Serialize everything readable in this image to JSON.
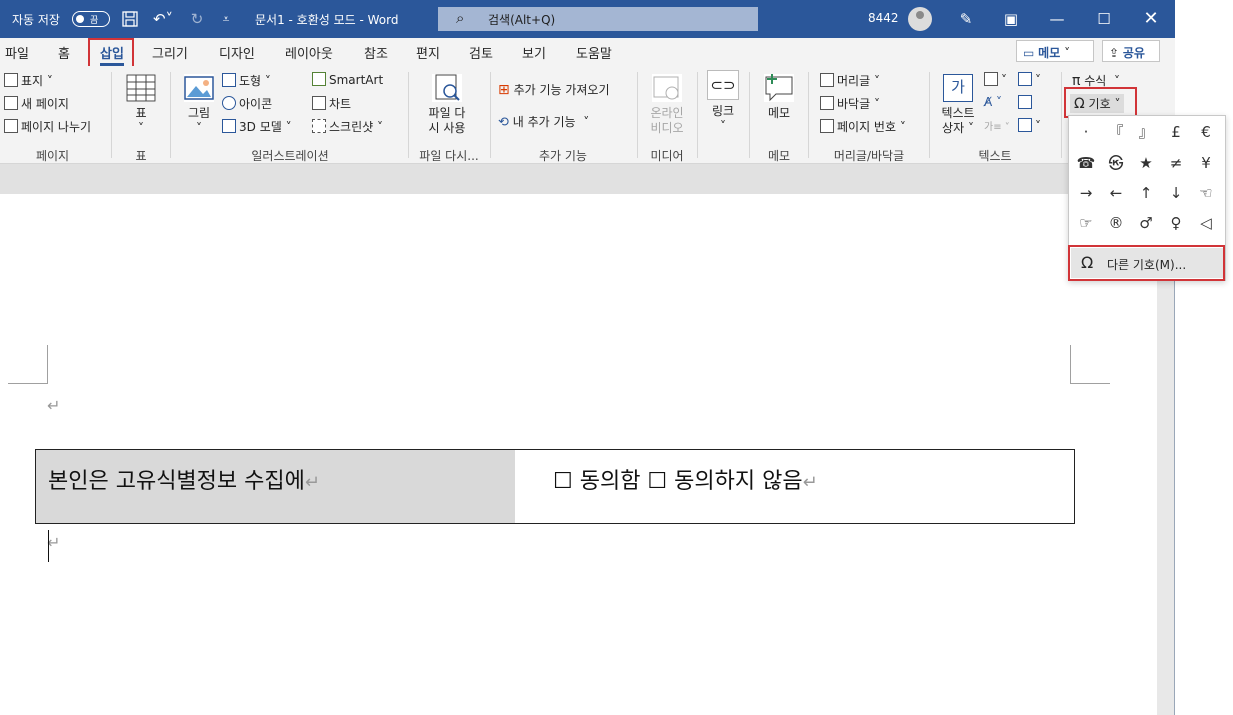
{
  "titlebar": {
    "autosave_label": "자동 저장",
    "autosave_state": "끔",
    "doc_title": "문서1 - 호환성 모드 - Word",
    "search_placeholder": "검색(Alt+Q)",
    "user_number": "8442"
  },
  "tabs": [
    "파일",
    "홈",
    "삽입",
    "그리기",
    "디자인",
    "레이아웃",
    "참조",
    "편지",
    "검토",
    "보기",
    "도움말"
  ],
  "active_tab": "삽입",
  "memo_button": "메모",
  "share_button": "공유",
  "ribbon": {
    "pages": {
      "items": [
        "표지",
        "새 페이지",
        "페이지 나누기"
      ],
      "group": "페이지"
    },
    "table": {
      "label": "표",
      "group": "표"
    },
    "illustrations": {
      "picture": "그림",
      "shapes": "도형",
      "icons": "아이콘",
      "model3d": "3D 모델",
      "smartart": "SmartArt",
      "chart": "차트",
      "screenshot": "스크린샷",
      "group": "일러스트레이션"
    },
    "reuse": {
      "line1": "파일 다",
      "line2": "시 사용",
      "group": "파일 다시..."
    },
    "addins": {
      "get": "추가 기능 가져오기",
      "mine": "내 추가 기능",
      "group": "추가 기능"
    },
    "media": {
      "line1": "온라인",
      "line2": "비디오",
      "group": "미디어"
    },
    "links": {
      "label": "링크",
      "group": ""
    },
    "comments": {
      "label": "메모",
      "group": "메모"
    },
    "headerfooter": {
      "header": "머리글",
      "footer": "바닥글",
      "pagenum": "페이지 번호",
      "group": "머리글/바닥글"
    },
    "text": {
      "line1": "텍스트",
      "line2": "상자",
      "group": "텍스트"
    },
    "symbols": {
      "equation": "수식",
      "symbol": "기호"
    }
  },
  "symbol_dropdown": {
    "symbols": [
      "·",
      "『",
      "』",
      "£",
      "€",
      "☎",
      "㉿",
      "★",
      "≠",
      "¥",
      "→",
      "←",
      "↑",
      "↓",
      "☜",
      "☞",
      "®",
      "♂",
      "♀",
      "◁"
    ],
    "more_symbols": "다른 기호(M)..."
  },
  "document": {
    "cell_left": "본인은 고유식별정보 수집에",
    "cell_right": "☐ 동의함 ☐ 동의하지 않음",
    "para_mark": "↵"
  }
}
